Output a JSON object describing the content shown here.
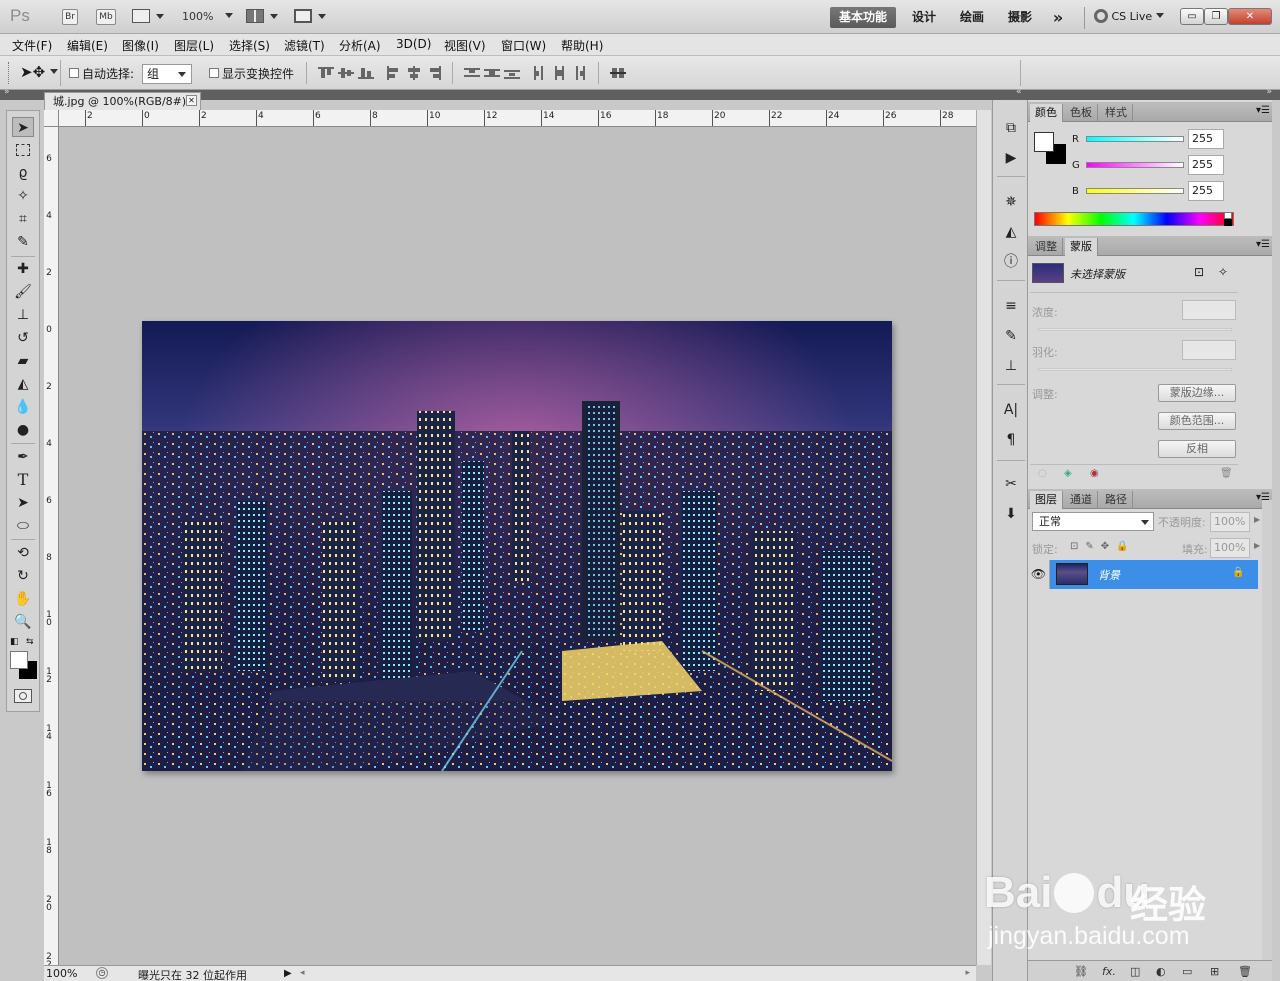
{
  "app": {
    "logo": "Ps",
    "bridge_label": "Br",
    "minibridge_label": "Mb",
    "zoom": "100%",
    "workspaces": [
      "基本功能",
      "设计",
      "绘画",
      "摄影"
    ],
    "more": "»",
    "cs_live": "CS Live",
    "window_buttons": [
      "▭",
      "❐",
      "✕"
    ]
  },
  "menu": [
    "文件(F)",
    "编辑(E)",
    "图像(I)",
    "图层(L)",
    "选择(S)",
    "滤镜(T)",
    "分析(A)",
    "3D(D)",
    "视图(V)",
    "窗口(W)",
    "帮助(H)"
  ],
  "options": {
    "auto_select_label": "自动选择:",
    "auto_select_value": "组",
    "transform_label": "显示变换控件"
  },
  "document": {
    "tab_title": "城.jpg @ 100%(RGB/8#)",
    "close_glyph": "✕",
    "ruler_top": [
      "2",
      "0",
      "2",
      "4",
      "6",
      "8",
      "10",
      "12",
      "14",
      "16",
      "18",
      "20",
      "22",
      "24",
      "26",
      "28"
    ],
    "ruler_left": [
      "6",
      "4",
      "2",
      "0",
      "2",
      "4",
      "6",
      "8",
      "10",
      "12",
      "14",
      "16",
      "18",
      "20",
      "22"
    ],
    "zoom": "100%",
    "status_text": "曝光只在 32 位起作用"
  },
  "color_panel": {
    "tabs": [
      "颜色",
      "色板",
      "样式"
    ],
    "r_label": "R",
    "g_label": "G",
    "b_label": "B",
    "r": "255",
    "g": "255",
    "b": "255"
  },
  "mask_panel": {
    "tabs": [
      "调整",
      "蒙版"
    ],
    "no_mask": "未选择蒙版",
    "density_label": "浓度:",
    "feather_label": "羽化:",
    "refine_label": "调整:",
    "mask_edge": "蒙版边缘...",
    "color_range": "颜色范围...",
    "invert": "反相"
  },
  "layers_panel": {
    "tabs": [
      "图层",
      "通道",
      "路径"
    ],
    "blend_mode": "正常",
    "opacity_label": "不透明度:",
    "opacity": "100%",
    "lock_label": "锁定:",
    "fill_label": "填充:",
    "fill": "100%",
    "layer_name": "背景",
    "footer_fx": "fx."
  },
  "watermark": {
    "brand": "Bai",
    "brand2": "du",
    "cn": "经验",
    "url": "jingyan.baidu.com"
  }
}
